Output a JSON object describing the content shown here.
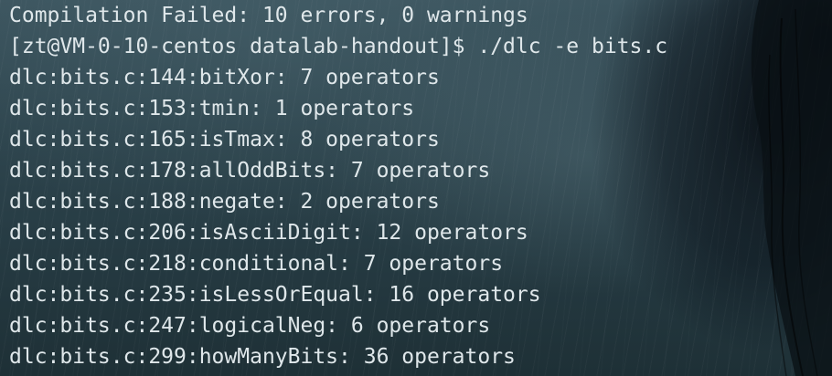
{
  "terminal": {
    "lines": [
      "Compilation Failed: 10 errors, 0 warnings",
      "[zt@VM-0-10-centos datalab-handout]$ ./dlc -e bits.c",
      "dlc:bits.c:144:bitXor: 7 operators",
      "dlc:bits.c:153:tmin: 1 operators",
      "dlc:bits.c:165:isTmax: 8 operators",
      "dlc:bits.c:178:allOddBits: 7 operators",
      "dlc:bits.c:188:negate: 2 operators",
      "dlc:bits.c:206:isAsciiDigit: 12 operators",
      "dlc:bits.c:218:conditional: 7 operators",
      "dlc:bits.c:235:isLessOrEqual: 16 operators",
      "dlc:bits.c:247:logicalNeg: 6 operators",
      "dlc:bits.c:299:howManyBits: 36 operators"
    ],
    "text_color": "#dfe7ea",
    "background_color": "#2f464f"
  }
}
